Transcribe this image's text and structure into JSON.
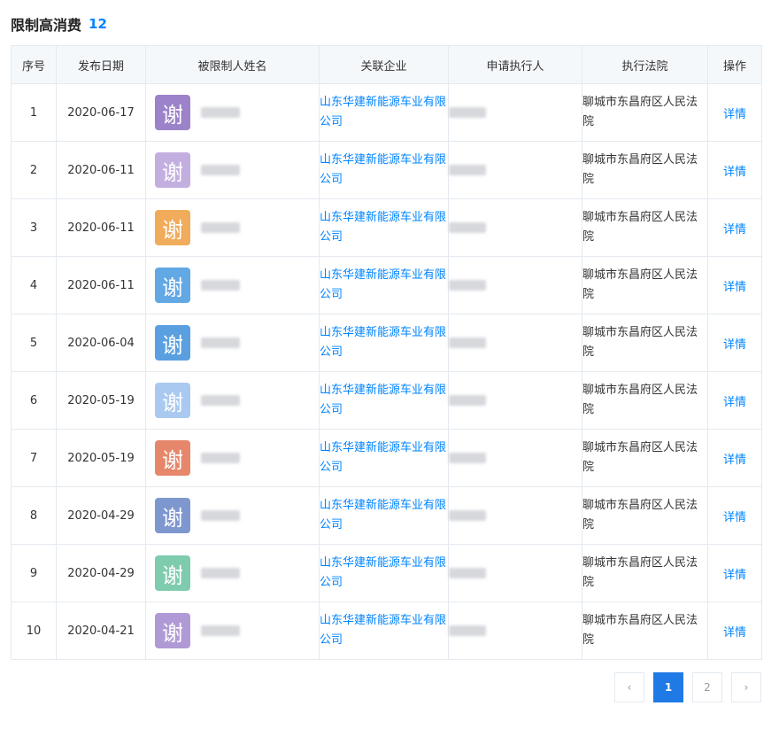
{
  "section": {
    "title": "限制高消费",
    "count": "12"
  },
  "table": {
    "headers": [
      "序号",
      "发布日期",
      "被限制人姓名",
      "关联企业",
      "申请执行人",
      "执行法院",
      "操作"
    ],
    "rows": [
      {
        "index": "1",
        "date": "2020-06-17",
        "avatar_char": "谢",
        "avatar_color": "#9b82c9",
        "company": "山东华建新能源车业有限公司",
        "court": "聊城市东昌府区人民法院",
        "action": "详情"
      },
      {
        "index": "2",
        "date": "2020-06-11",
        "avatar_char": "谢",
        "avatar_color": "#c3aee0",
        "company": "山东华建新能源车业有限公司",
        "court": "聊城市东昌府区人民法院",
        "action": "详情"
      },
      {
        "index": "3",
        "date": "2020-06-11",
        "avatar_char": "谢",
        "avatar_color": "#f0ab5b",
        "company": "山东华建新能源车业有限公司",
        "court": "聊城市东昌府区人民法院",
        "action": "详情"
      },
      {
        "index": "4",
        "date": "2020-06-11",
        "avatar_char": "谢",
        "avatar_color": "#62a8e5",
        "company": "山东华建新能源车业有限公司",
        "court": "聊城市东昌府区人民法院",
        "action": "详情"
      },
      {
        "index": "5",
        "date": "2020-06-04",
        "avatar_char": "谢",
        "avatar_color": "#5aa0e0",
        "company": "山东华建新能源车业有限公司",
        "court": "聊城市东昌府区人民法院",
        "action": "详情"
      },
      {
        "index": "6",
        "date": "2020-05-19",
        "avatar_char": "谢",
        "avatar_color": "#a9c9f0",
        "company": "山东华建新能源车业有限公司",
        "court": "聊城市东昌府区人民法院",
        "action": "详情"
      },
      {
        "index": "7",
        "date": "2020-05-19",
        "avatar_char": "谢",
        "avatar_color": "#e6876c",
        "company": "山东华建新能源车业有限公司",
        "court": "聊城市东昌府区人民法院",
        "action": "详情"
      },
      {
        "index": "8",
        "date": "2020-04-29",
        "avatar_char": "谢",
        "avatar_color": "#7f97cf",
        "company": "山东华建新能源车业有限公司",
        "court": "聊城市东昌府区人民法院",
        "action": "详情"
      },
      {
        "index": "9",
        "date": "2020-04-29",
        "avatar_char": "谢",
        "avatar_color": "#7fcbae",
        "company": "山东华建新能源车业有限公司",
        "court": "聊城市东昌府区人民法院",
        "action": "详情"
      },
      {
        "index": "10",
        "date": "2020-04-21",
        "avatar_char": "谢",
        "avatar_color": "#b09ad6",
        "company": "山东华建新能源车业有限公司",
        "court": "聊城市东昌府区人民法院",
        "action": "详情"
      }
    ]
  },
  "pagination": {
    "prev": "‹",
    "current": "1",
    "page2": "2",
    "next": "›"
  }
}
